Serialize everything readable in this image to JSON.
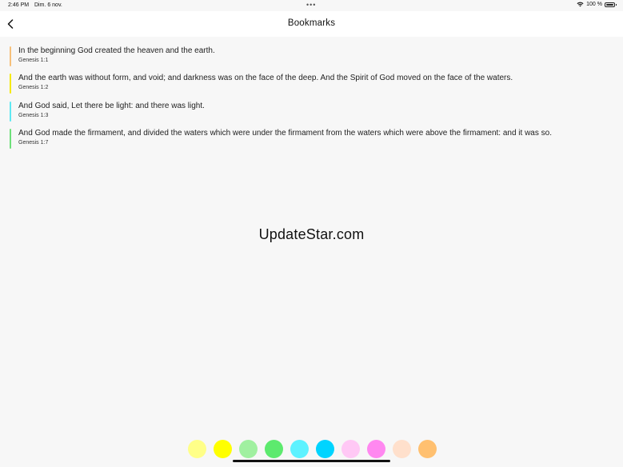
{
  "status_bar": {
    "time": "2:46 PM",
    "date": "Dim. 6 nov.",
    "dots": "•••",
    "battery": "100 %",
    "icons": [
      "wifi-icon",
      "battery-icon"
    ]
  },
  "nav": {
    "title": "Bookmarks",
    "back_icon": "chevron-left-icon"
  },
  "bookmarks": [
    {
      "text": "In the beginning God created the heaven and the earth.",
      "ref": "Genesis 1:1",
      "color": "#f6c07a"
    },
    {
      "text": "And the earth was without form, and void; and darkness was on the face of the deep. And the Spirit of God moved on the face of the waters.",
      "ref": "Genesis 1:2",
      "color": "#f5e900"
    },
    {
      "text": "And God said, Let there be light: and there was light.",
      "ref": "Genesis 1:3",
      "color": "#5ee8f2"
    },
    {
      "text": "And God made the firmament, and divided the waters which were under the firmament from the waters which were above the firmament: and it was so.",
      "ref": "Genesis 1:7",
      "color": "#6ee07a"
    }
  ],
  "watermark": "UpdateStar.com",
  "colors": [
    "#ffff88",
    "#ffff00",
    "#a0f0a0",
    "#5dea6e",
    "#5df2ff",
    "#00d4ff",
    "#ffc8f5",
    "#ff88f0",
    "#ffe0cc",
    "#ffc070"
  ]
}
